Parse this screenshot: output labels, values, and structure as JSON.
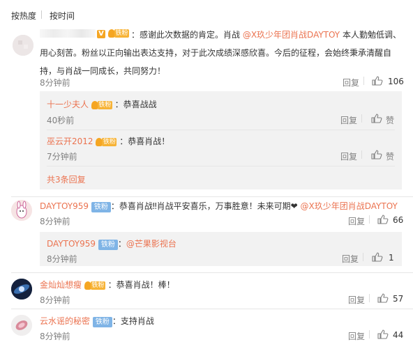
{
  "sort": {
    "by_hot": "按热度",
    "by_time": "按时间"
  },
  "comments": [
    {
      "username": "",
      "badge": "铁粉",
      "text_prefix": "：感谢此次数据的肯定。肖战 ",
      "mention": "@X玖少年团肖战DAYTOY",
      "text_suffix": " 本人勤勉低调、",
      "line2": "用心刻苦。粉丝以正向输出表达支持，对于此次成绩深感欣喜。今后的征程，会始终秉承清醒自",
      "line3": "持，与肖战一同成长，共同努力！",
      "time": "8分钟前",
      "reply_label": "回复",
      "likes": "106",
      "replies": [
        {
          "username": "十一少夫人",
          "badge": "铁粉",
          "text": "：恭喜战战",
          "time": "40秒前",
          "reply_label": "回复",
          "like_label": "赞"
        },
        {
          "username": "巫云开2012",
          "badge": "铁粉",
          "text": "：恭喜肖战！",
          "time": "7分钟前",
          "reply_label": "回复",
          "like_label": "赞"
        }
      ],
      "more_replies": "共3条回复"
    },
    {
      "username": "DAYTOY959",
      "badge": "铁粉",
      "text_prefix": "：恭喜肖战‼肖战平安喜乐，万事胜意！未来可期❤ ",
      "mention": "@X玖少年团肖战DAYTOY",
      "time": "8分钟前",
      "reply_label": "回复",
      "likes": "66",
      "replies": [
        {
          "username": "DAYTOY959",
          "badge": "铁粉",
          "text": "：",
          "mention": "@芒果影视台",
          "time": "8分钟前",
          "reply_label": "回复",
          "likes": "1"
        }
      ]
    },
    {
      "username": "金灿灿想瘦",
      "badge": "铁粉",
      "text": "：恭喜肖战！棒！",
      "time": "8分钟前",
      "reply_label": "回复",
      "likes": "57"
    },
    {
      "username": "云水谣的秘密",
      "badge": "铁粉",
      "text": "：支持肖战",
      "time": "8分钟前",
      "reply_label": "回复",
      "likes": "44"
    }
  ],
  "colors": {
    "link": "#eb7350",
    "fan_badge": "#7fb4e6",
    "reply_bg": "#f2f2f2"
  }
}
